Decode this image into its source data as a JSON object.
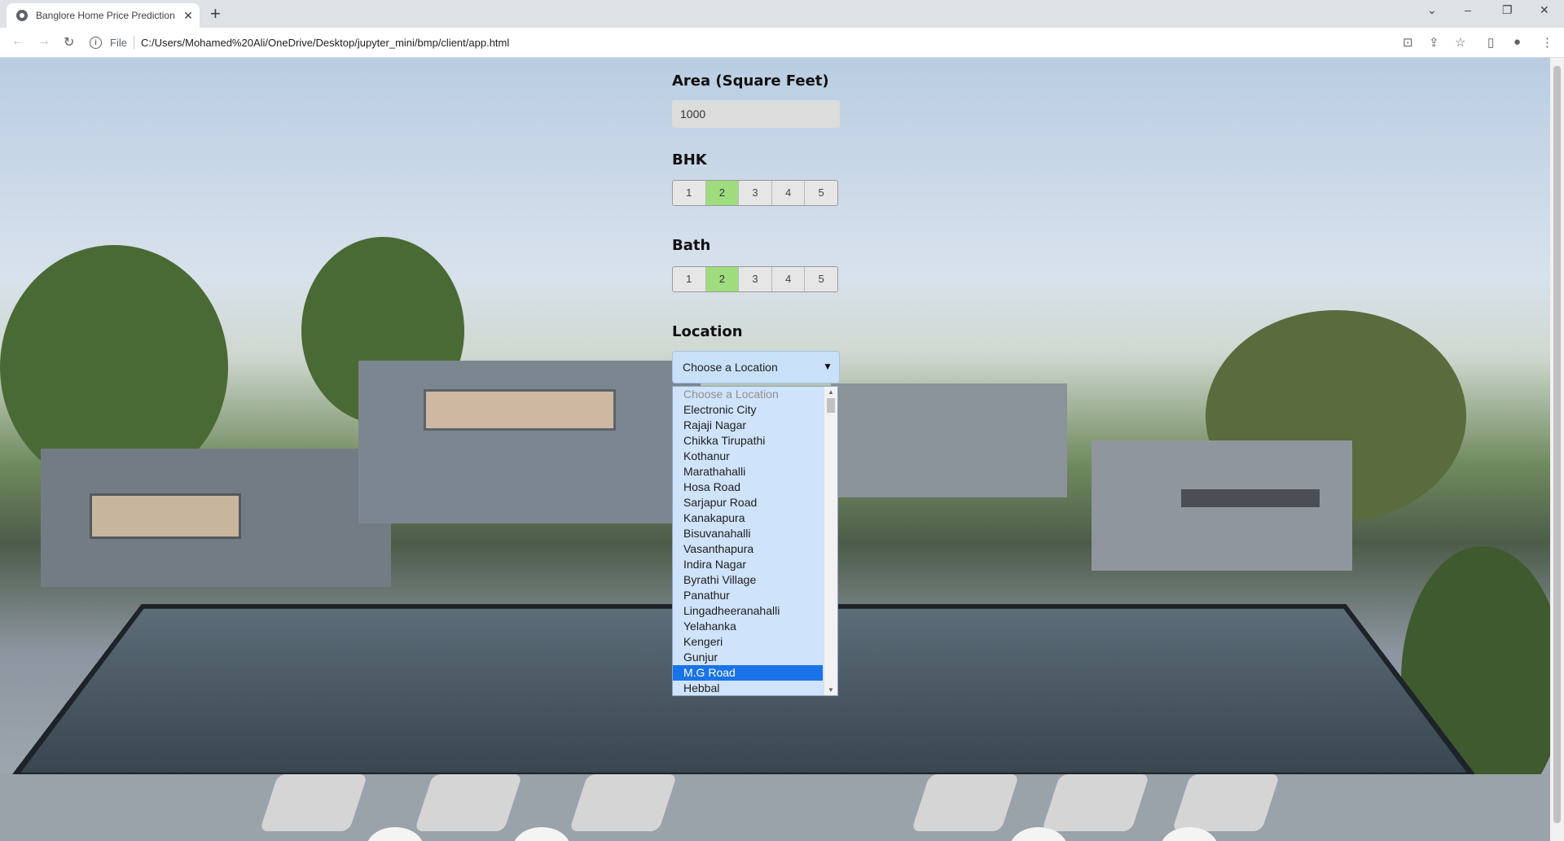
{
  "browser": {
    "tab_title": "Banglore Home Price Prediction",
    "tab_close": "✕",
    "new_tab": "+",
    "window_controls": {
      "tab_search": "⌄",
      "minimize": "–",
      "maximize": "❐",
      "close": "✕"
    },
    "address": {
      "scheme": "File",
      "url": "C:/Users/Mohamed%20Ali/OneDrive/Desktop/jupyter_mini/bmp/client/app.html"
    }
  },
  "form": {
    "area": {
      "label": "Area (Square Feet)",
      "value": "1000"
    },
    "bhk": {
      "label": "BHK",
      "options": [
        "1",
        "2",
        "3",
        "4",
        "5"
      ],
      "selected": "2"
    },
    "bath": {
      "label": "Bath",
      "options": [
        "1",
        "2",
        "3",
        "4",
        "5"
      ],
      "selected": "2"
    },
    "location": {
      "label": "Location",
      "selected": "Choose a Location",
      "highlighted": "M.G Road",
      "options": [
        "Choose a Location",
        "Electronic City",
        "Rajaji Nagar",
        "Chikka Tirupathi",
        "Kothanur",
        "Marathahalli",
        "Hosa Road",
        "Sarjapur Road",
        "Kanakapura",
        "Bisuvanahalli",
        "Vasanthapura",
        "Indira Nagar",
        "Byrathi Village",
        "Panathur",
        "Lingadheeranahalli",
        "Yelahanka",
        "Kengeri",
        "Gunjur",
        "M.G Road",
        "Hebbal"
      ]
    }
  },
  "colors": {
    "selected_switch": "#9fdc7e",
    "dropdown_bg": "#cfe3fa",
    "highlight": "#1a73e8"
  }
}
